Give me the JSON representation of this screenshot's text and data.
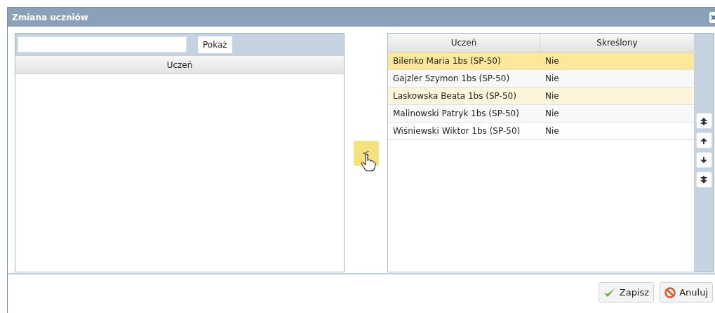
{
  "window": {
    "title": "Zmiana uczniów"
  },
  "left_panel": {
    "show_button": "Pokaż",
    "columns": [
      "Uczeń"
    ]
  },
  "move_button": "<",
  "right_panel": {
    "columns": [
      "Uczeń",
      "Skreślony"
    ],
    "rows": [
      {
        "student": "Bilenko Maria 1bs (SP-50)",
        "struck_off": "Nie",
        "selected": true,
        "hovered": false
      },
      {
        "student": "Gajzler Szymon 1bs (SP-50)",
        "struck_off": "Nie",
        "selected": false,
        "hovered": false
      },
      {
        "student": "Laskowska Beata 1bs (SP-50)",
        "struck_off": "Nie",
        "selected": false,
        "hovered": true
      },
      {
        "student": "Malinowski Patryk 1bs (SP-50)",
        "struck_off": "Nie",
        "selected": false,
        "hovered": false
      },
      {
        "student": "Wiśniewski Wiktor 1bs (SP-50)",
        "struck_off": "Nie",
        "selected": false,
        "hovered": false
      }
    ]
  },
  "footer": {
    "buttons": [
      {
        "kind": "save",
        "label": "Zapisz"
      },
      {
        "kind": "cancel",
        "label": "Anuluj"
      }
    ]
  }
}
